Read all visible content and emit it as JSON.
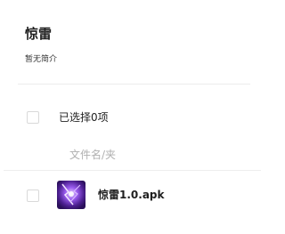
{
  "header": {
    "title": "惊雷",
    "description": "暂无简介"
  },
  "toolbar": {
    "selected_count_label": "已选择0项"
  },
  "table": {
    "column_header": "文件名/夹",
    "rows": [
      {
        "name": "惊雷1.0.apk",
        "icon": "app-thumbnail-icon"
      }
    ]
  },
  "colors": {
    "divider": "#ececec",
    "placeholder_text": "#b0b0b0",
    "thumbnail_primary": "#5a2ea6"
  }
}
